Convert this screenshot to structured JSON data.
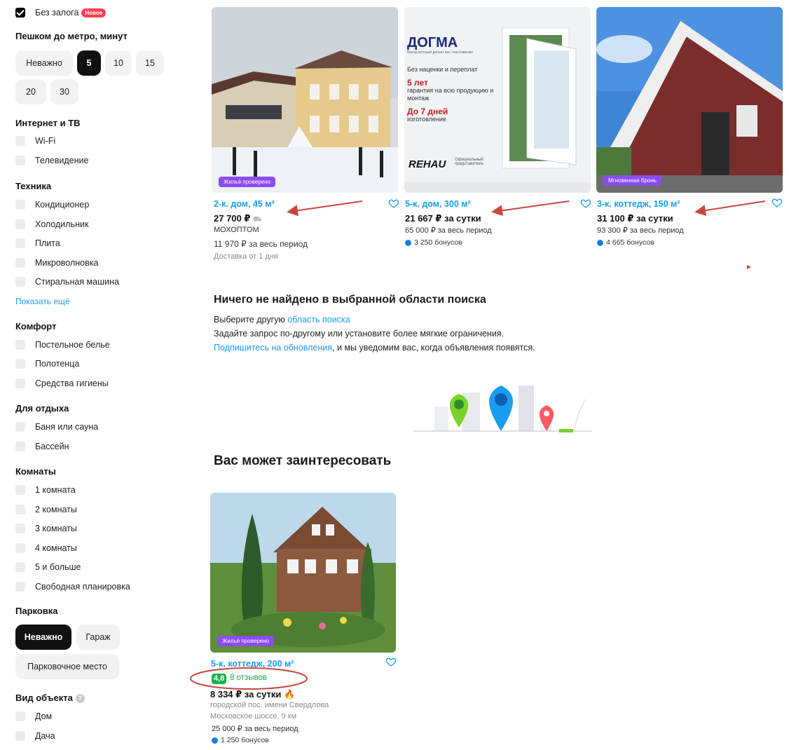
{
  "filters": {
    "no_deposit": {
      "label": "Без залога",
      "badge": "Новое"
    },
    "metro": {
      "title": "Пешком до метро, минут",
      "options": [
        "Неважно",
        "5",
        "10",
        "15",
        "20",
        "30"
      ],
      "selected": "5"
    },
    "internet": {
      "title": "Интернет и ТВ",
      "items": [
        "Wi-Fi",
        "Телевидение"
      ]
    },
    "appliances": {
      "title": "Техника",
      "items": [
        "Кондиционер",
        "Холодильник",
        "Плита",
        "Микроволновка",
        "Стиральная машина"
      ],
      "show_more": "Показать ещё"
    },
    "comfort": {
      "title": "Комфорт",
      "items": [
        "Постельное белье",
        "Полотенца",
        "Средства гигиены"
      ]
    },
    "leisure": {
      "title": "Для отдыха",
      "items": [
        "Баня или сауна",
        "Бассейн"
      ]
    },
    "rooms": {
      "title": "Комнаты",
      "items": [
        "1 комната",
        "2 комнаты",
        "3 комнаты",
        "4 комнаты",
        "5 и больше",
        "Свободная планировка"
      ]
    },
    "parking": {
      "title": "Парковка",
      "options": [
        "Неважно",
        "Гараж",
        "Парковочное место"
      ],
      "selected": "Неважно"
    },
    "object_type": {
      "title": "Вид объекта",
      "items": [
        "Дом",
        "Дача"
      ]
    }
  },
  "listings": [
    {
      "badge": "Жильё проверено",
      "title": "2-к. дом, 45 м²",
      "price": "27 700 ₽",
      "seller": "МОХОПТОМ",
      "total": "11 970 ₽ за весь период",
      "delivery": "Доставка от 1 дня"
    },
    {
      "ad_brand": "ДОГМА",
      "ad_caption": "Бренд который делает вас счастливыми",
      "ad_lines": [
        "Без наценки и переплат",
        "5 лет",
        "гарантия на всю продукцию и монтаж",
        "До 7 дней",
        "изготовление"
      ],
      "ad_partner": "REHAU",
      "ad_partner_note": "Официальный представитель",
      "title": "5-к. дом, 300 м²",
      "price": "21 667 ₽ за сутки",
      "total": "65 000 ₽ за весь период",
      "bonus": "3 250 бонусов"
    },
    {
      "badge": "Мгновенная бронь",
      "title": "3-к. коттедж, 150 м²",
      "price": "31 100 ₽ за сутки",
      "total": "93 300 ₽ за весь период",
      "bonus": "4 665 бонусов"
    }
  ],
  "not_found": {
    "title": "Ничего не найдено в выбранной области поиска",
    "line1_prefix": "Выберите другую ",
    "line1_link": "область поиска",
    "line2": "Задайте запрос по-другому или установите более мягкие ограничения.",
    "line3_link": "Подпишитесь на обновления",
    "line3_suffix": ", и мы уведомим вас, когда объявления появятся."
  },
  "recommend": {
    "title": "Вас может заинтересовать",
    "card": {
      "badge": "Жильё проверено",
      "title": "5-к. коттедж, 200 м²",
      "rating": "4,8",
      "reviews": "8 отзывов",
      "price": "8 334 ₽ за сутки",
      "address1": "городской пос. имени Свердлова",
      "address2": "Московское шоссе, 9 км",
      "total": "25 000 ₽ за весь период",
      "bonus": "1 250 бонусов"
    }
  },
  "colors": {
    "accent_link": "#1a9cf0",
    "badge_verified": "#8b4df0",
    "new_badge": "#ff4053",
    "rating_green": "#18b24a",
    "annotation_red": "#c8463e"
  }
}
